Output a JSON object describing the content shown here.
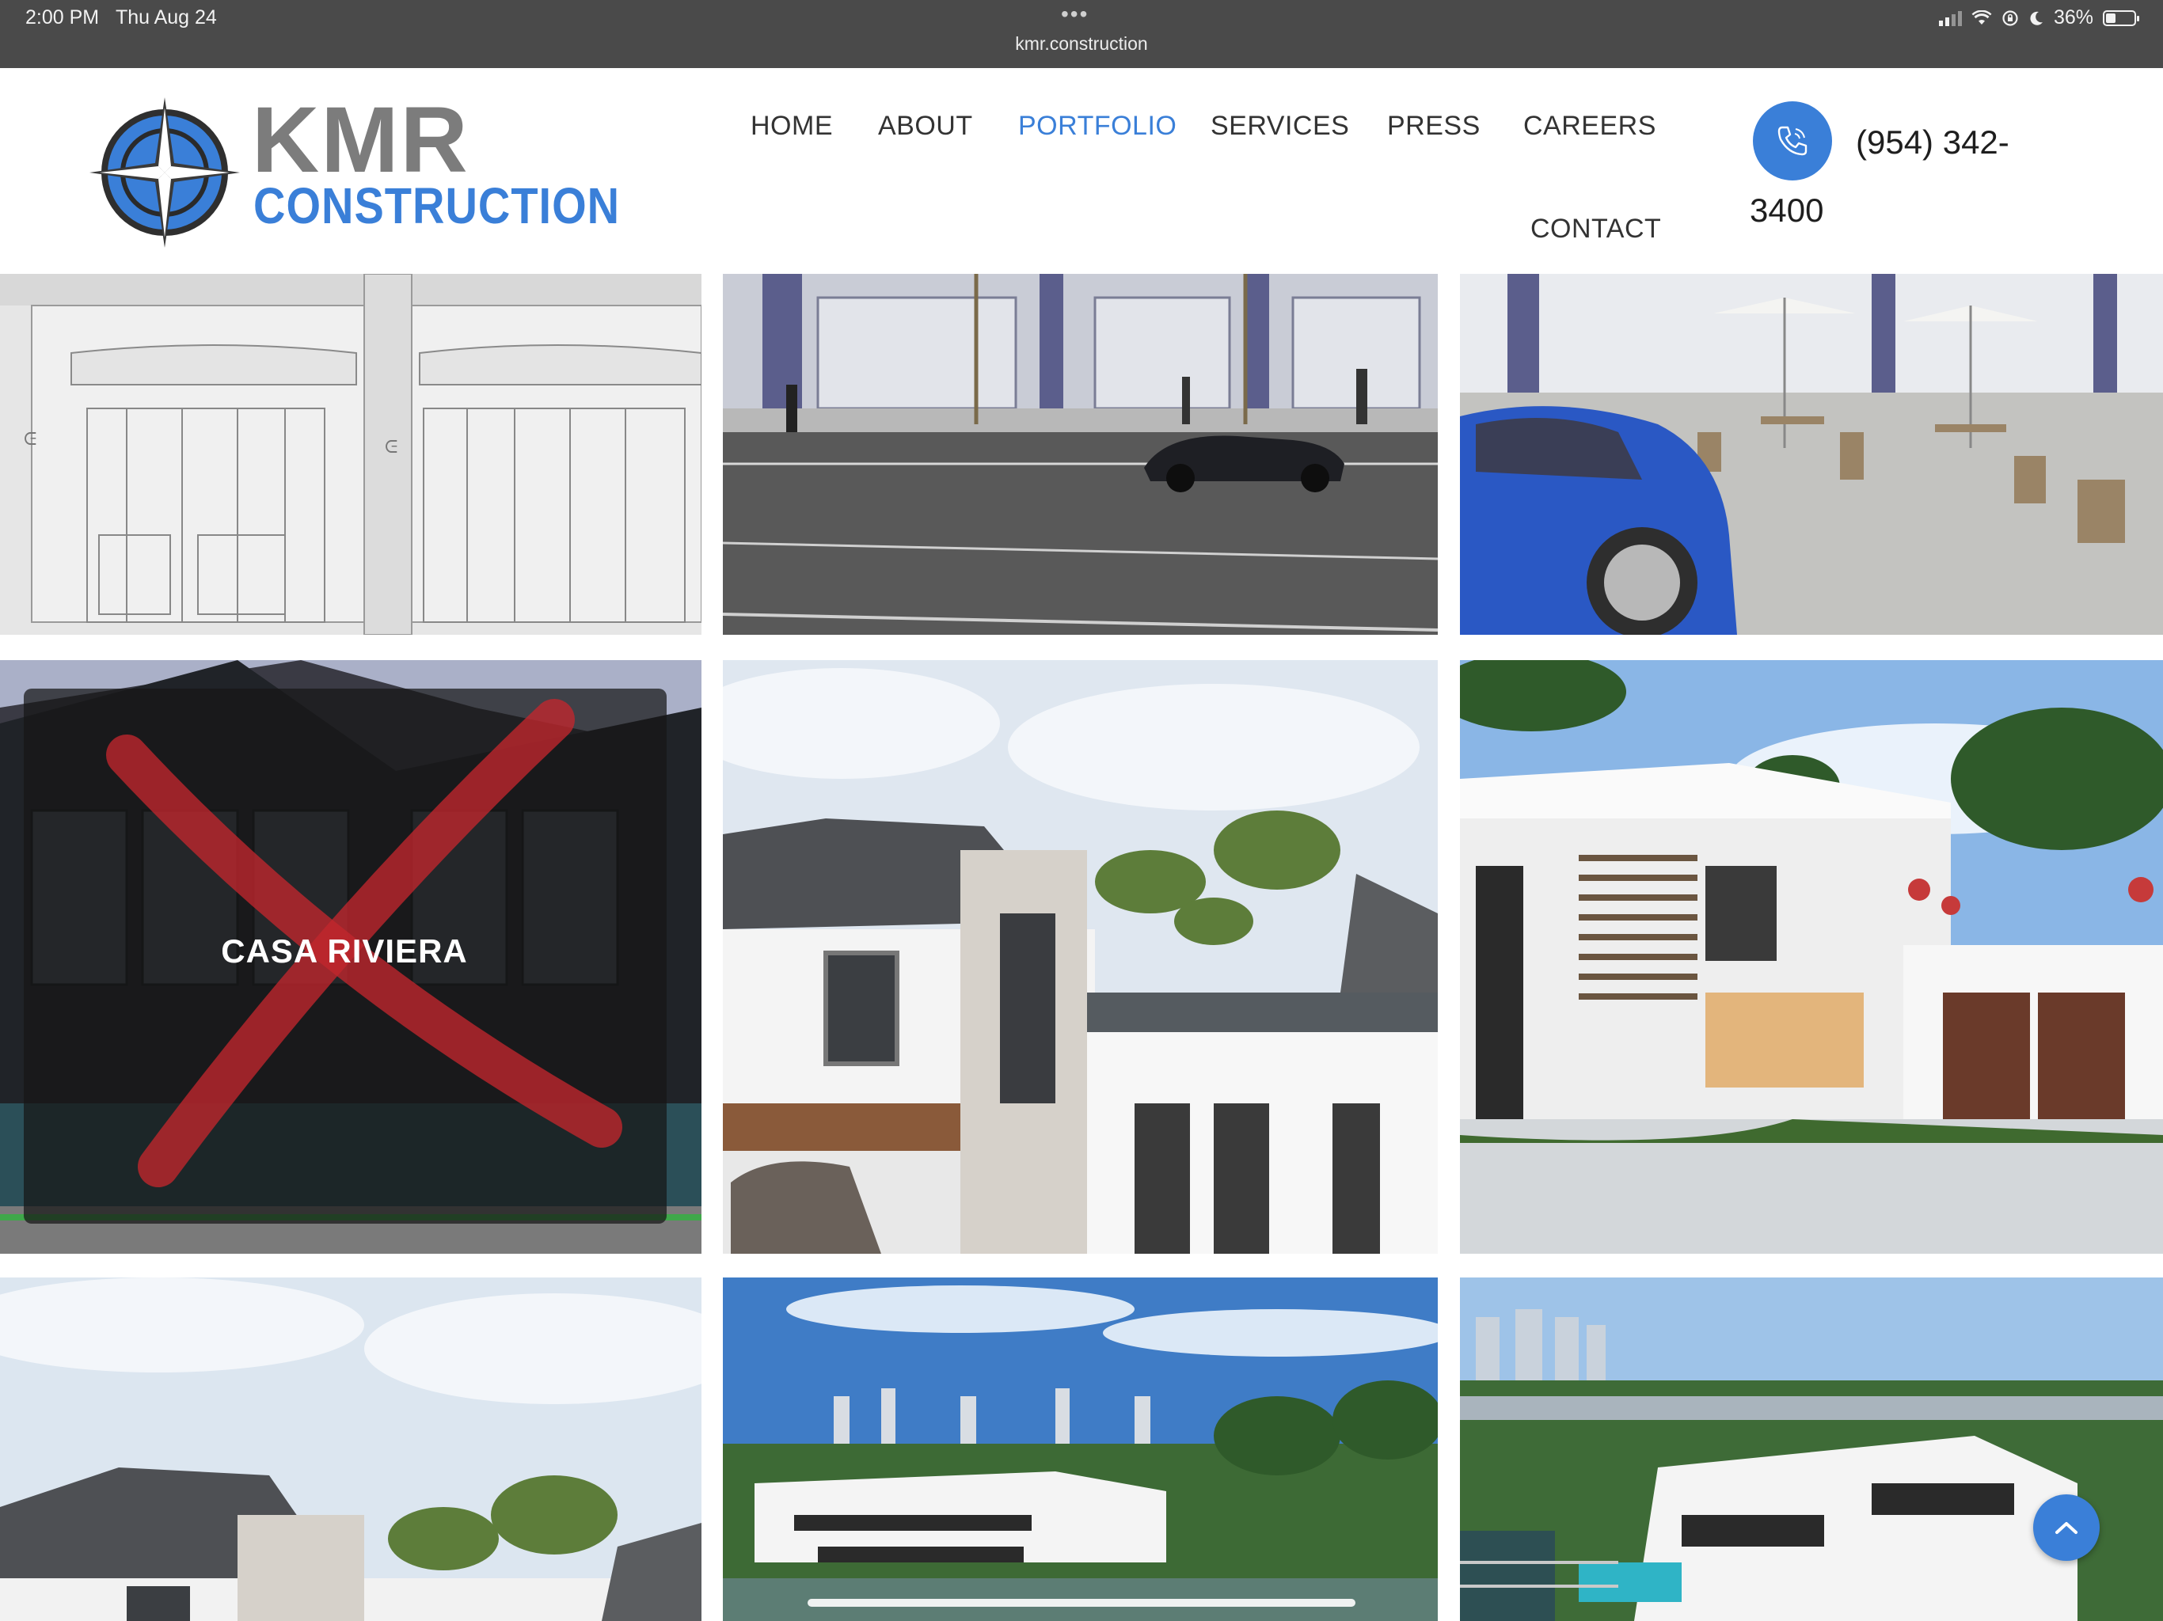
{
  "status_bar": {
    "time": "2:00 PM",
    "date": "Thu Aug 24",
    "url": "kmr.construction",
    "battery": "36%"
  },
  "header": {
    "logo": {
      "line1": "KMR",
      "line2": "CONSTRUCTION"
    },
    "nav": [
      "HOME",
      "ABOUT",
      "PORTFOLIO",
      "SERVICES",
      "PRESS",
      "CAREERS",
      "CONTACT"
    ],
    "active_nav": "PORTFOLIO",
    "phone_line1": "(954) 342-",
    "phone_line2": "3400"
  },
  "portfolio": {
    "hover_title": "CASA RIVIERA"
  },
  "colors": {
    "accent": "#3a7fd8",
    "status_bar": "#4a4a4a"
  },
  "icons": {
    "phone": "phone-icon",
    "scroll_top": "chevron-up-icon"
  }
}
